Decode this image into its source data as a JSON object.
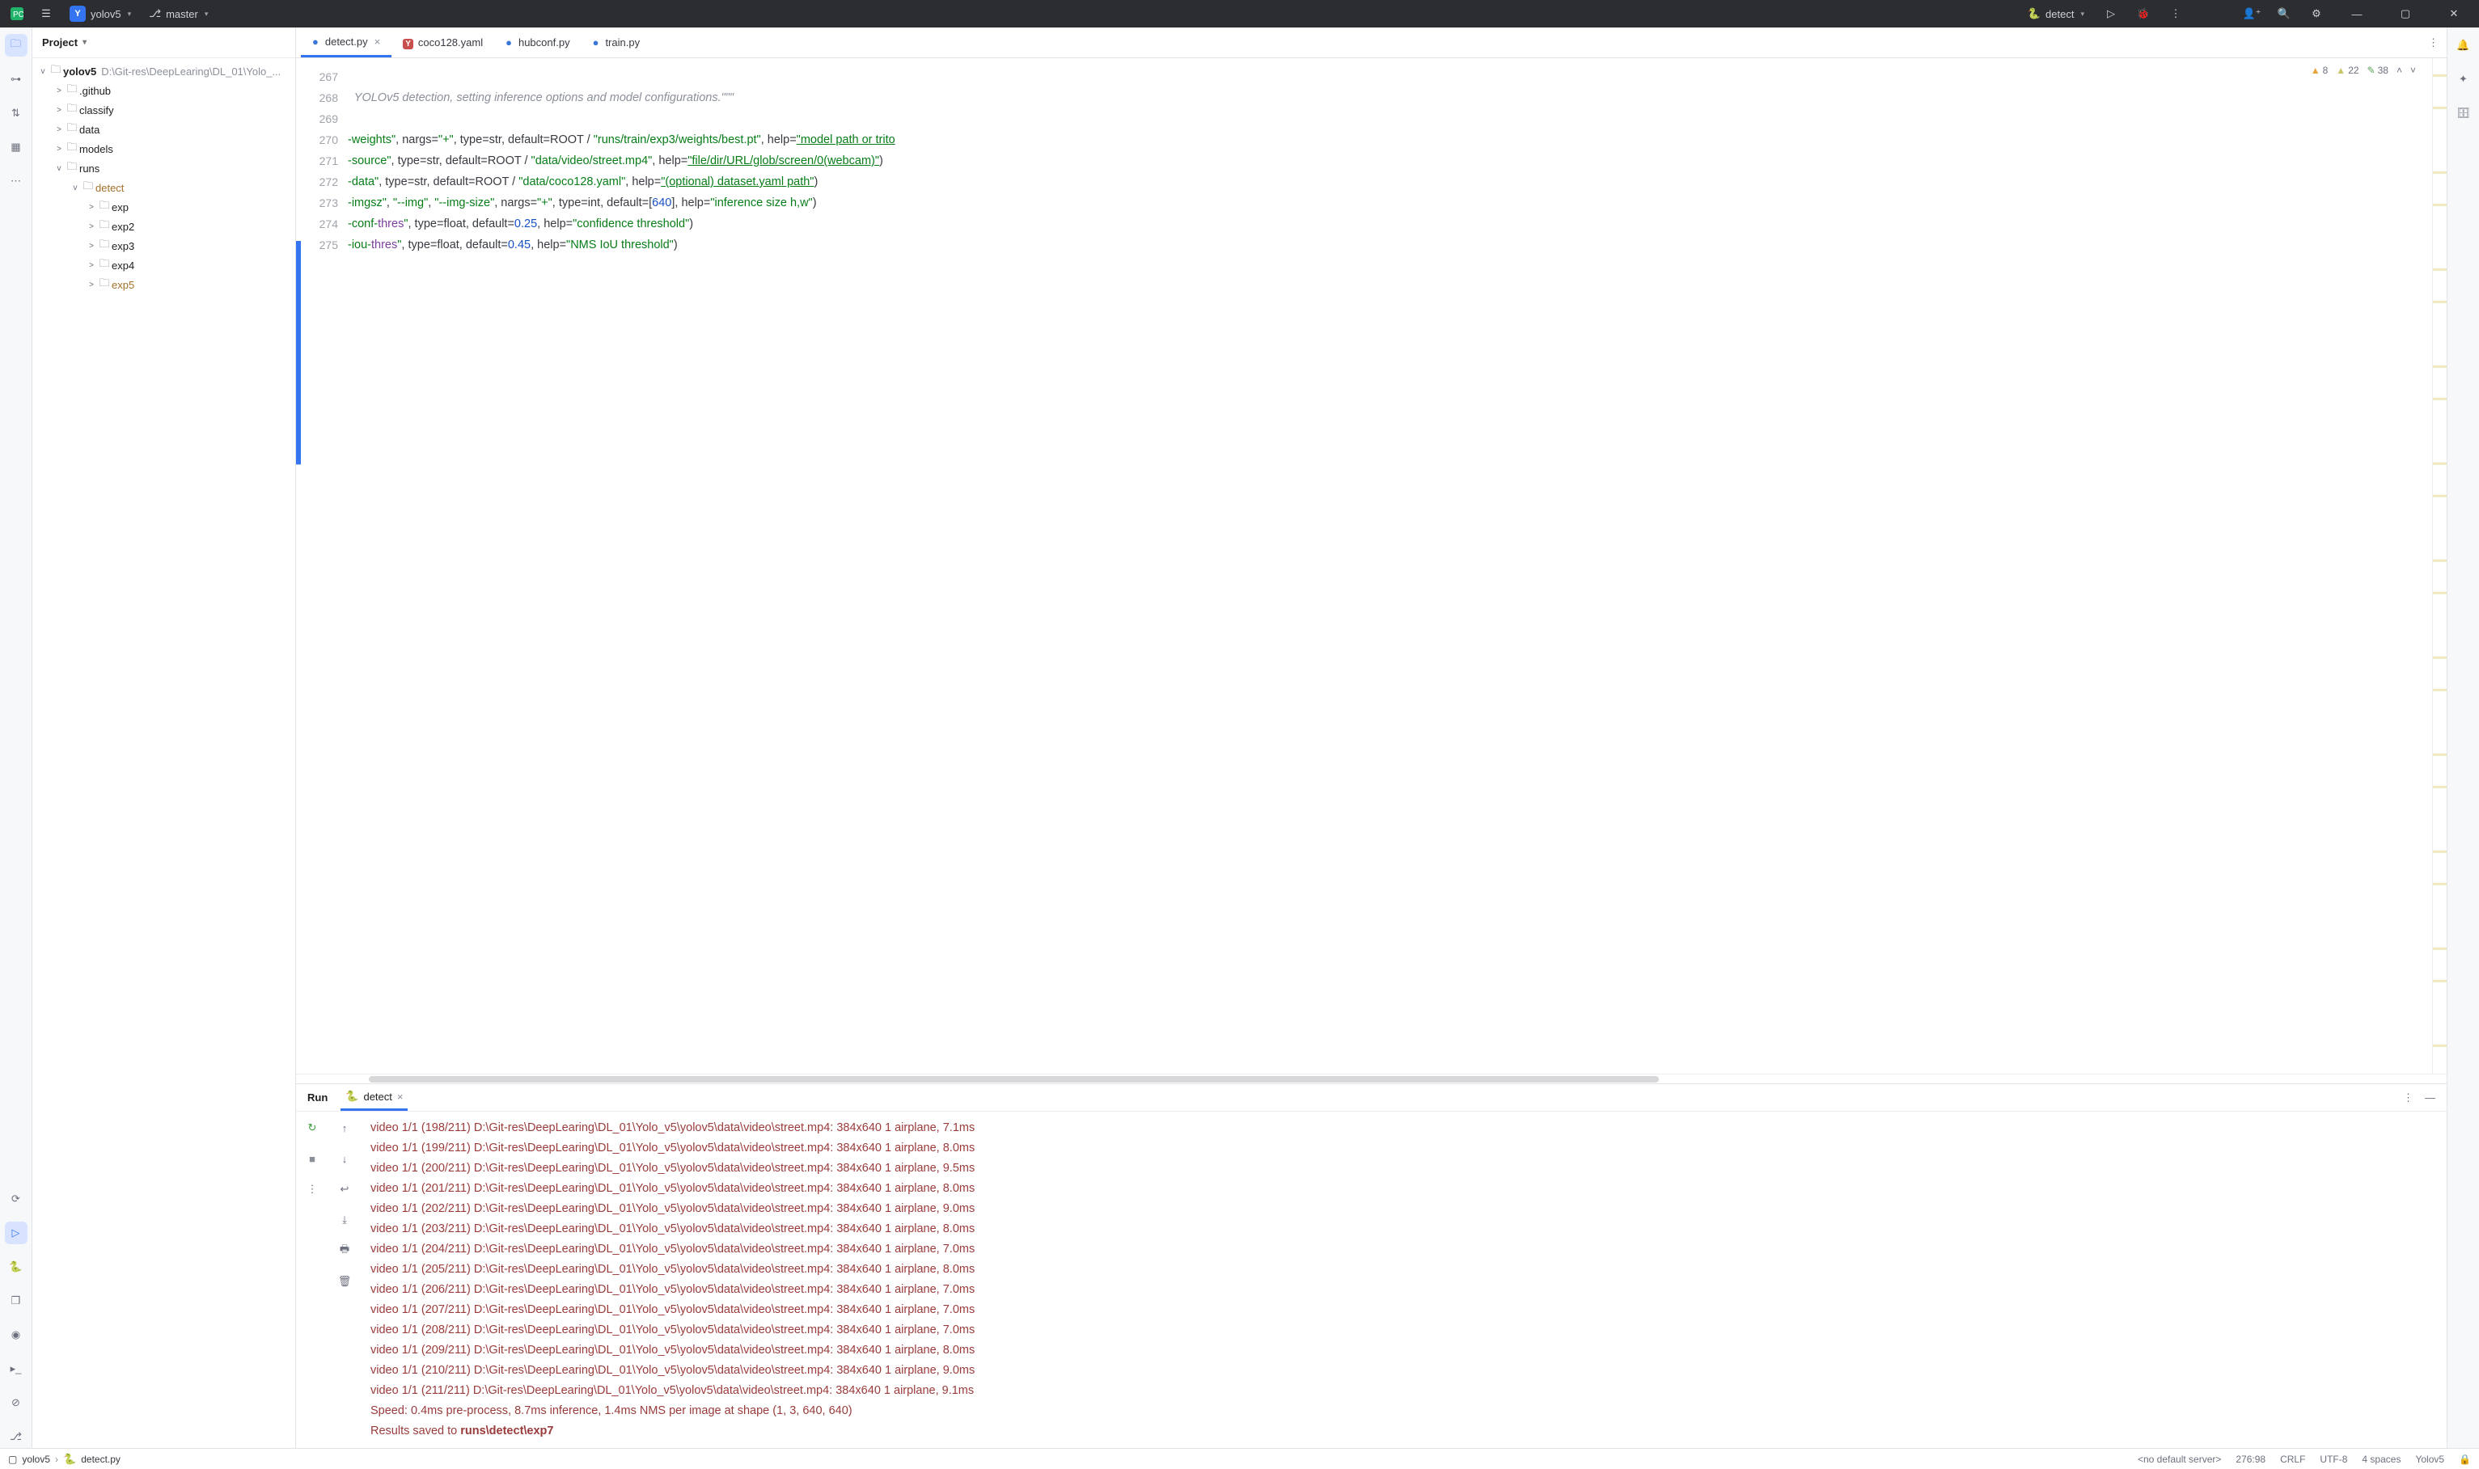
{
  "titlebar": {
    "project_letter": "Y",
    "project_name": "yolov5",
    "branch_name": "master",
    "run_config": "detect"
  },
  "project_panel": {
    "title": "Project",
    "root": {
      "name": "yolov5",
      "path": "D:\\Git-res\\DeepLearing\\DL_01\\Yolo_..."
    },
    "nodes": [
      {
        "indent": 1,
        "expand": ">",
        "icon": "folder",
        "label": ".github"
      },
      {
        "indent": 1,
        "expand": ">",
        "icon": "folder",
        "label": "classify"
      },
      {
        "indent": 1,
        "expand": ">",
        "icon": "folder",
        "label": "data"
      },
      {
        "indent": 1,
        "expand": ">",
        "icon": "folder",
        "label": "models"
      },
      {
        "indent": 1,
        "expand": "v",
        "icon": "folder",
        "label": "runs"
      },
      {
        "indent": 2,
        "expand": "v",
        "icon": "folder",
        "label": "detect",
        "brown": true
      },
      {
        "indent": 3,
        "expand": ">",
        "icon": "folder",
        "label": "exp"
      },
      {
        "indent": 3,
        "expand": ">",
        "icon": "folder",
        "label": "exp2"
      },
      {
        "indent": 3,
        "expand": ">",
        "icon": "folder",
        "label": "exp3"
      },
      {
        "indent": 3,
        "expand": ">",
        "icon": "folder",
        "label": "exp4"
      },
      {
        "indent": 3,
        "expand": ">",
        "icon": "folder",
        "label": "exp5",
        "brown": true
      }
    ]
  },
  "tabs": [
    {
      "icon": "py",
      "label": "detect.py",
      "active": true,
      "closable": true
    },
    {
      "icon": "yml",
      "label": "coco128.yaml"
    },
    {
      "icon": "py",
      "label": "hubconf.py"
    },
    {
      "icon": "py",
      "label": "train.py"
    }
  ],
  "inspections": {
    "warn": "8",
    "weak": "22",
    "typo": "38"
  },
  "code": {
    "lines": [
      267,
      268,
      269,
      270,
      271,
      272,
      273,
      274,
      275
    ]
  },
  "run": {
    "title": "Run",
    "tab_label": "detect",
    "log": [
      "video 1/1 (198/211) D:\\Git-res\\DeepLearing\\DL_01\\Yolo_v5\\yolov5\\data\\video\\street.mp4: 384x640 1 airplane, 7.1ms",
      "video 1/1 (199/211) D:\\Git-res\\DeepLearing\\DL_01\\Yolo_v5\\yolov5\\data\\video\\street.mp4: 384x640 1 airplane, 8.0ms",
      "video 1/1 (200/211) D:\\Git-res\\DeepLearing\\DL_01\\Yolo_v5\\yolov5\\data\\video\\street.mp4: 384x640 1 airplane, 9.5ms",
      "video 1/1 (201/211) D:\\Git-res\\DeepLearing\\DL_01\\Yolo_v5\\yolov5\\data\\video\\street.mp4: 384x640 1 airplane, 8.0ms",
      "video 1/1 (202/211) D:\\Git-res\\DeepLearing\\DL_01\\Yolo_v5\\yolov5\\data\\video\\street.mp4: 384x640 1 airplane, 9.0ms",
      "video 1/1 (203/211) D:\\Git-res\\DeepLearing\\DL_01\\Yolo_v5\\yolov5\\data\\video\\street.mp4: 384x640 1 airplane, 8.0ms",
      "video 1/1 (204/211) D:\\Git-res\\DeepLearing\\DL_01\\Yolo_v5\\yolov5\\data\\video\\street.mp4: 384x640 1 airplane, 7.0ms",
      "video 1/1 (205/211) D:\\Git-res\\DeepLearing\\DL_01\\Yolo_v5\\yolov5\\data\\video\\street.mp4: 384x640 1 airplane, 8.0ms",
      "video 1/1 (206/211) D:\\Git-res\\DeepLearing\\DL_01\\Yolo_v5\\yolov5\\data\\video\\street.mp4: 384x640 1 airplane, 7.0ms",
      "video 1/1 (207/211) D:\\Git-res\\DeepLearing\\DL_01\\Yolo_v5\\yolov5\\data\\video\\street.mp4: 384x640 1 airplane, 7.0ms",
      "video 1/1 (208/211) D:\\Git-res\\DeepLearing\\DL_01\\Yolo_v5\\yolov5\\data\\video\\street.mp4: 384x640 1 airplane, 7.0ms",
      "video 1/1 (209/211) D:\\Git-res\\DeepLearing\\DL_01\\Yolo_v5\\yolov5\\data\\video\\street.mp4: 384x640 1 airplane, 8.0ms",
      "video 1/1 (210/211) D:\\Git-res\\DeepLearing\\DL_01\\Yolo_v5\\yolov5\\data\\video\\street.mp4: 384x640 1 airplane, 9.0ms",
      "video 1/1 (211/211) D:\\Git-res\\DeepLearing\\DL_01\\Yolo_v5\\yolov5\\data\\video\\street.mp4: 384x640 1 airplane, 9.1ms"
    ],
    "speed_line": "Speed: 0.4ms pre-process, 8.7ms inference, 1.4ms NMS per image at shape (1, 3, 640, 640)",
    "result_prefix": "Results saved to ",
    "result_path": "runs\\detect\\exp7"
  },
  "statusbar": {
    "crumb_project": "yolov5",
    "crumb_file": "detect.py",
    "server": "<no default server>",
    "pos": "276:98",
    "eol": "CRLF",
    "enc": "UTF-8",
    "indent": "4 spaces",
    "interp": "Yolov5"
  }
}
